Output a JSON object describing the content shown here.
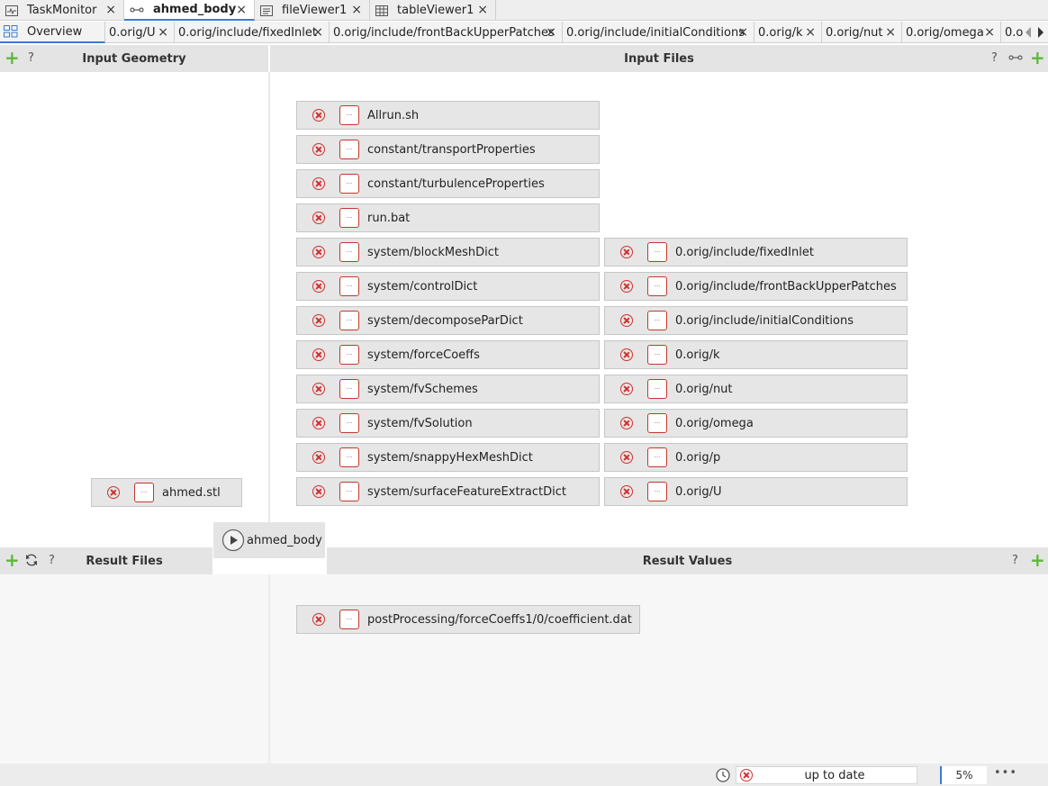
{
  "top_tabs": [
    {
      "label": "TaskMonitor",
      "icon": "task-monitor-icon"
    },
    {
      "label": "ahmed_body",
      "icon": "workflow-icon"
    },
    {
      "label": "fileViewer1",
      "icon": "file-viewer-icon"
    },
    {
      "label": "tableViewer1",
      "icon": "table-icon"
    }
  ],
  "sub_tabs": [
    {
      "label": "Overview"
    },
    {
      "label": "0.orig/U"
    },
    {
      "label": "0.orig/include/fixedInlet"
    },
    {
      "label": "0.orig/include/frontBackUpperPatches"
    },
    {
      "label": "0.orig/include/initialConditions"
    },
    {
      "label": "0.orig/k"
    },
    {
      "label": "0.orig/nut"
    },
    {
      "label": "0.orig/omega"
    },
    {
      "label": "0.o"
    }
  ],
  "sections": {
    "input_geometry": "Input Geometry",
    "input_files": "Input Files",
    "result_files": "Result Files",
    "result_values": "Result Values"
  },
  "input_files_left": [
    "Allrun.sh",
    "constant/transportProperties",
    "constant/turbulenceProperties",
    "run.bat",
    "system/blockMeshDict",
    "system/controlDict",
    "system/decomposeParDict",
    "system/forceCoeffs",
    "system/fvSchemes",
    "system/fvSolution",
    "system/snappyHexMeshDict",
    "system/surfaceFeatureExtractDict"
  ],
  "input_files_right": [
    "0.orig/include/fixedInlet",
    "0.orig/include/frontBackUpperPatches",
    "0.orig/include/initialConditions",
    "0.orig/k",
    "0.orig/nut",
    "0.orig/omega",
    "0.orig/p",
    "0.orig/U"
  ],
  "geometry_file": "ahmed.stl",
  "run_button_label": "ahmed_body",
  "result_values": [
    "postProcessing/forceCoeffs1/0/coefficient.dat"
  ],
  "status": {
    "text": "up to date",
    "progress": "5%",
    "more": "•••"
  },
  "help_symbol": "?",
  "add_symbol": "+",
  "close_symbol": "×",
  "colors": {
    "accent": "#3b7bd0",
    "error": "#d0302f",
    "add": "#5cb83a"
  }
}
